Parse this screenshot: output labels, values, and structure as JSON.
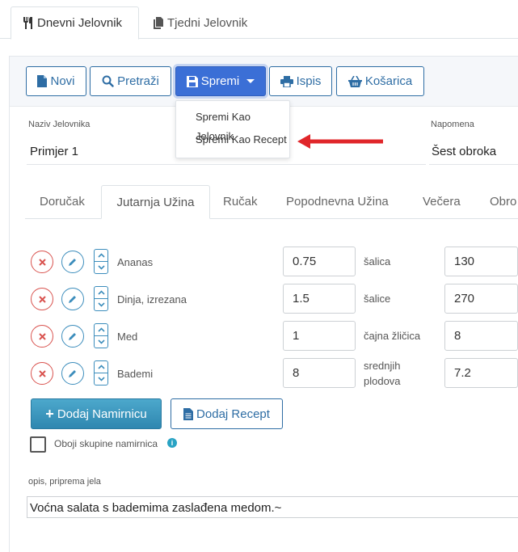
{
  "top_tabs": [
    {
      "label": "Dnevni Jelovnik",
      "icon": "cutlery-icon",
      "active": true
    },
    {
      "label": "Tjedni Jelovnik",
      "icon": "copy-icon",
      "active": false
    }
  ],
  "toolbar": {
    "new_label": "Novi",
    "search_label": "Pretraži",
    "save_label": "Spremi",
    "print_label": "Ispis",
    "basket_label": "Košarica"
  },
  "save_menu": {
    "items": [
      "Spremi Kao Jelovnik",
      "Spremi Kao Recept"
    ]
  },
  "form": {
    "menu_name_label": "Naziv Jelovnika",
    "menu_name_value": "Primjer 1",
    "note_label": "Napomena",
    "note_value": "Šest obroka"
  },
  "meal_tabs": [
    "Doručak",
    "Jutarnja Užina",
    "Ručak",
    "Popodnevna Užina",
    "Večera",
    "Obro"
  ],
  "active_meal_tab": "Jutarnja Užina",
  "foods": [
    {
      "name": "Ananas",
      "quantity": "0.75",
      "unit": "šalica",
      "amount": "130"
    },
    {
      "name": "Dinja, izrezana",
      "quantity": "1.5",
      "unit": "šalice",
      "amount": "270"
    },
    {
      "name": "Med",
      "quantity": "1",
      "unit": "čajna žličica",
      "amount": "8"
    },
    {
      "name": "Bademi",
      "quantity": "8",
      "unit_line1": "srednjih",
      "unit_line2": "plodova",
      "amount": "7.2"
    }
  ],
  "actions": {
    "add_food_label": "Dodaj Namirnicu",
    "add_recipe_label": "Dodaj Recept",
    "color_groups_label": "Oboji skupine namirnica"
  },
  "description": {
    "label": "opis, priprema jela",
    "value": "Voćna salata s bademima zaslađena medom.~"
  },
  "colors": {
    "primary": "#3b6fd6",
    "link_blue": "#2e6da4",
    "danger": "#d9534f",
    "info": "#29a3c4",
    "arrow": "#e0262a"
  }
}
